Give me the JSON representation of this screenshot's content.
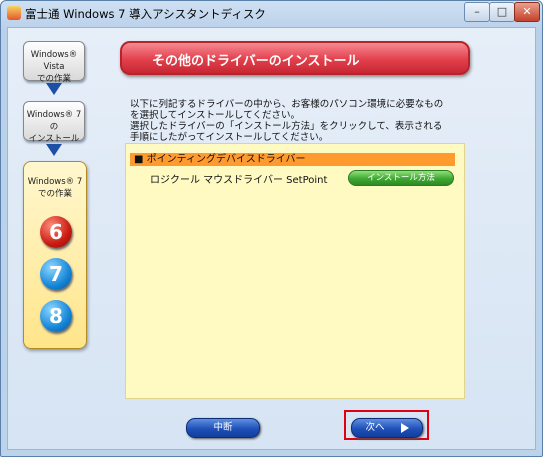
{
  "window": {
    "title": "富士通 Windows 7 導入アシスタントディスク"
  },
  "steps": {
    "step1": [
      "Windows® Vista",
      "での作業"
    ],
    "step2": [
      "Windows® 7 の",
      "インストール"
    ],
    "step3": [
      "Windows® 7",
      "での作業"
    ],
    "numbers": [
      "6",
      "7",
      "8"
    ]
  },
  "banner": {
    "title": "その他のドライバーのインストール"
  },
  "instructions": [
    "以下に列記するドライバーの中から、お客様のパソコン環境に必要なもの",
    "を選択してインストールしてください。",
    "選択したドライバーの「インストール方法」をクリックして、表示される",
    "手順にしたがってインストールしてください。"
  ],
  "drivers": {
    "section": "■ ポインティングデバイスドライバー",
    "name": "ロジクール マウスドライバー SetPoint",
    "install_label": "インストール方法"
  },
  "buttons": {
    "stop": "中断",
    "next": "次へ"
  },
  "colors": {
    "banner": "#e2404c",
    "section": "#ff9a2e",
    "content": "#fff9c2",
    "next_highlight": "#e0000f"
  }
}
